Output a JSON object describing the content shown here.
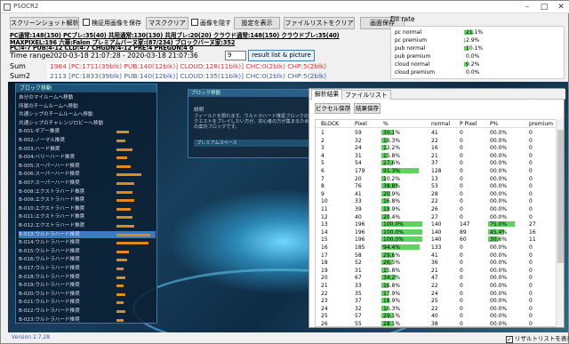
{
  "window": {
    "title": "PSOCR2"
  },
  "toolbar": {
    "screenshot_analysis": "スクリーンショット解析",
    "save_verify_image": "検証用画像を保存",
    "mask_clear": "マスククリア",
    "hide_image": "画像を隠す",
    "show_settings": "設定を表示",
    "clear_file_list": "ファイルリストをクリア",
    "save_screen": "画面保存"
  },
  "summary": {
    "line1": "PC通常:148(150) PCブレ:35(40) 共用通常:130(130) 共用ブレ:20(20) クラウド通常:148(150) クラウドブレ:35(40)",
    "line2": "MAXPIXEL:196 六華:Falon プレミアムバーヌ家:(87/234) ブロックバーヌ家:352",
    "line3": "PC:4-7 PUB:4-12 CLD:4-7 CHGDN:4-12 PRE:4 PREGDN:4 o"
  },
  "time_range": {
    "label": "Time range",
    "value": "2020-03-18 21:07:28 - 2020-03-18 21:07:36",
    "spin": "9",
    "button": "result list & picture"
  },
  "sum": {
    "label": "Sum",
    "text": "1984 [PC:1711(39blk) PUB:140(12blk)] CLOUD:128(11blk)] CHC:0(2blk) CHP:5(2blk)"
  },
  "sum2": {
    "label": "Sum2",
    "text": "2113 [PC:1833(39blk) PUB:140(12blk)] CLOUD:135(11blk)] CHC:0(2blk) CHP:5(2blk)"
  },
  "fill_rate": {
    "title": "Fill rate",
    "rows": [
      {
        "name": "pc normal",
        "value": "21.1%",
        "pct": 21.1
      },
      {
        "name": "pc premium",
        "value": "2.9%",
        "pct": 2.9
      },
      {
        "name": "pub normal",
        "value": "10.1%",
        "pct": 10.1
      },
      {
        "name": "pub premium",
        "value": "0.0%",
        "pct": 0
      },
      {
        "name": "cloud normal",
        "value": "9.2%",
        "pct": 9.2
      },
      {
        "name": "cloud premium",
        "value": "0.0%",
        "pct": 0
      }
    ]
  },
  "game": {
    "list_header": "ブロック移動",
    "items": [
      {
        "label": "自分のマイルームへ移動",
        "bar": 0
      },
      {
        "label": "所属のチームルームへ移動",
        "bar": 0
      },
      {
        "label": "共通シップのチームルームへ移動",
        "bar": 0
      },
      {
        "label": "共通シップのチャレンジロビーへ移動",
        "bar": 0
      },
      {
        "label": "B-001:ギアー推奨",
        "bar": 0.35
      },
      {
        "label": "B-002:ノーマル推奨",
        "bar": 0.25
      },
      {
        "label": "B-003:ハード推奨",
        "bar": 0.45
      },
      {
        "label": "B-004:ベリーハード推奨",
        "bar": 0.3
      },
      {
        "label": "B-005:スーパーハード推奨",
        "bar": 0.4
      },
      {
        "label": "B-006:スーパーハード推奨",
        "bar": 0.7
      },
      {
        "label": "B-007:スーパーハード推奨",
        "bar": 0.5
      },
      {
        "label": "B-008:エクストラハード推奨",
        "bar": 0.45
      },
      {
        "label": "B-009:エクストラハード推奨",
        "bar": 0.5
      },
      {
        "label": "B-010:エクストラハード推奨",
        "bar": 0.4
      },
      {
        "label": "B-011:エクストラハード推奨",
        "bar": 0.45
      },
      {
        "label": "B-012:エクストラハード推奨",
        "bar": 0.5
      },
      {
        "label": "B-013:ウルトラハード推奨",
        "bar": 0.95
      },
      {
        "label": "B-014:ウルトラハード推奨",
        "bar": 0.9
      },
      {
        "label": "B-015:ウルトラハード推奨",
        "bar": 0.35
      },
      {
        "label": "B-016:ウルトラハード推奨",
        "bar": 0.3
      },
      {
        "label": "B-017:ウルトラハード推奨",
        "bar": 0.2
      },
      {
        "label": "B-018:ウルトラハード推奨",
        "bar": 0.25
      },
      {
        "label": "B-019:ウルトラハード推奨",
        "bar": 0.2
      },
      {
        "label": "B-020:ウルトラハード推奨",
        "bar": 0.25
      },
      {
        "label": "B-021:ウルトラハード推奨",
        "bar": 0.2
      },
      {
        "label": "B-022:ウルトラハード推奨",
        "bar": 0.25
      },
      {
        "label": "B-023:ウルトラハード推奨",
        "bar": 0.2
      }
    ],
    "panel_header": "ブロック移動",
    "panel_sub": "説明",
    "panel_desc": "フィールドを限れます。ウルトラハード推奨ブロックのクエストをプレイしたい方が、初心者の方が集まるための案内ブロックです。",
    "panel_bar": "プレミアムスペース"
  },
  "version": "Version 2.7.28",
  "results": {
    "tabs": [
      "解析結果",
      "ファイルリスト"
    ],
    "copy_button": "ビクセル保存",
    "save_button": "結果保存",
    "columns": [
      "BLOCK",
      "Pixel",
      "%",
      "normal",
      "P Pixel",
      "P%",
      "premium"
    ],
    "rows": [
      {
        "block": "1",
        "pixel": "59",
        "pct": "30.1%",
        "pv": 30.1,
        "normal": "41",
        "ppixel": "0",
        "ppct": "00.0%",
        "ppv": 0,
        "premium": "0"
      },
      {
        "block": "2",
        "pixel": "32",
        "pct": "16.3%",
        "pv": 16.3,
        "normal": "22",
        "ppixel": "0",
        "ppct": "00.0%",
        "ppv": 0,
        "premium": "0"
      },
      {
        "block": "3",
        "pixel": "24",
        "pct": "12.2%",
        "pv": 12.2,
        "normal": "16",
        "ppixel": "0",
        "ppct": "00.0%",
        "ppv": 0,
        "premium": "0"
      },
      {
        "block": "4",
        "pixel": "31",
        "pct": "15.8%",
        "pv": 15.8,
        "normal": "21",
        "ppixel": "0",
        "ppct": "00.0%",
        "ppv": 0,
        "premium": "0"
      },
      {
        "block": "5",
        "pixel": "54",
        "pct": "27.6%",
        "pv": 27.6,
        "normal": "37",
        "ppixel": "0",
        "ppct": "00.0%",
        "ppv": 0,
        "premium": "0"
      },
      {
        "block": "6",
        "pixel": "179",
        "pct": "91.3%",
        "pv": 91.3,
        "normal": "128",
        "ppixel": "0",
        "ppct": "00.0%",
        "ppv": 0,
        "premium": "0"
      },
      {
        "block": "7",
        "pixel": "20",
        "pct": "10.2%",
        "pv": 10.2,
        "normal": "13",
        "ppixel": "0",
        "ppct": "00.0%",
        "ppv": 0,
        "premium": "0"
      },
      {
        "block": "8",
        "pixel": "76",
        "pct": "38.8%",
        "pv": 38.8,
        "normal": "53",
        "ppixel": "0",
        "ppct": "00.0%",
        "ppv": 0,
        "premium": "0"
      },
      {
        "block": "9",
        "pixel": "41",
        "pct": "20.9%",
        "pv": 20.9,
        "normal": "28",
        "ppixel": "0",
        "ppct": "00.0%",
        "ppv": 0,
        "premium": "0"
      },
      {
        "block": "10",
        "pixel": "33",
        "pct": "16.8%",
        "pv": 16.8,
        "normal": "22",
        "ppixel": "0",
        "ppct": "00.0%",
        "ppv": 0,
        "premium": "0"
      },
      {
        "block": "11",
        "pixel": "39",
        "pct": "19.9%",
        "pv": 19.9,
        "normal": "26",
        "ppixel": "0",
        "ppct": "00.0%",
        "ppv": 0,
        "premium": "0"
      },
      {
        "block": "12",
        "pixel": "40",
        "pct": "20.4%",
        "pv": 20.4,
        "normal": "27",
        "ppixel": "0",
        "ppct": "00.0%",
        "ppv": 0,
        "premium": "0"
      },
      {
        "block": "13",
        "pixel": "196",
        "pct": "100.0%",
        "pv": 100,
        "normal": "140",
        "ppixel": "147",
        "ppct": "75.0%",
        "ppv": 75,
        "premium": "27"
      },
      {
        "block": "14",
        "pixel": "196",
        "pct": "100.0%",
        "pv": 100,
        "normal": "140",
        "ppixel": "89",
        "ppct": "45.4%",
        "ppv": 45.4,
        "premium": "16"
      },
      {
        "block": "15",
        "pixel": "196",
        "pct": "100.0%",
        "pv": 100,
        "normal": "140",
        "ppixel": "60",
        "ppct": "30.6%",
        "ppv": 30.6,
        "premium": "11"
      },
      {
        "block": "16",
        "pixel": "185",
        "pct": "94.4%",
        "pv": 94.4,
        "normal": "133",
        "ppixel": "0",
        "ppct": "00.0%",
        "ppv": 0,
        "premium": "0"
      },
      {
        "block": "17",
        "pixel": "58",
        "pct": "29.6%",
        "pv": 29.6,
        "normal": "41",
        "ppixel": "0",
        "ppct": "00.0%",
        "ppv": 0,
        "premium": "0"
      },
      {
        "block": "18",
        "pixel": "52",
        "pct": "26.5%",
        "pv": 26.5,
        "normal": "36",
        "ppixel": "0",
        "ppct": "00.0%",
        "ppv": 0,
        "premium": "0"
      },
      {
        "block": "19",
        "pixel": "31",
        "pct": "15.8%",
        "pv": 15.8,
        "normal": "21",
        "ppixel": "0",
        "ppct": "00.0%",
        "ppv": 0,
        "premium": "0"
      },
      {
        "block": "20",
        "pixel": "67",
        "pct": "34.2%",
        "pv": 34.2,
        "normal": "47",
        "ppixel": "0",
        "ppct": "00.0%",
        "ppv": 0,
        "premium": "0"
      },
      {
        "block": "21",
        "pixel": "33",
        "pct": "16.8%",
        "pv": 16.8,
        "normal": "22",
        "ppixel": "0",
        "ppct": "00.0%",
        "ppv": 0,
        "premium": "0"
      },
      {
        "block": "22",
        "pixel": "35",
        "pct": "17.9%",
        "pv": 17.9,
        "normal": "24",
        "ppixel": "0",
        "ppct": "00.0%",
        "ppv": 0,
        "premium": "0"
      },
      {
        "block": "23",
        "pixel": "37",
        "pct": "18.9%",
        "pv": 18.9,
        "normal": "25",
        "ppixel": "0",
        "ppct": "00.0%",
        "ppv": 0,
        "premium": "0"
      },
      {
        "block": "24",
        "pixel": "32",
        "pct": "16.3%",
        "pv": 16.3,
        "normal": "22",
        "ppixel": "0",
        "ppct": "00.0%",
        "ppv": 0,
        "premium": "0"
      },
      {
        "block": "25",
        "pixel": "57",
        "pct": "29.1%",
        "pv": 29.1,
        "normal": "40",
        "ppixel": "0",
        "ppct": "00.0%",
        "ppv": 0,
        "premium": "0"
      },
      {
        "block": "26",
        "pixel": "55",
        "pct": "28.1%",
        "pv": 28.1,
        "normal": "38",
        "ppixel": "0",
        "ppct": "00.0%",
        "ppv": 0,
        "premium": "0"
      }
    ]
  },
  "show_results": {
    "label": "リザルトリストを表示",
    "checked": true
  }
}
